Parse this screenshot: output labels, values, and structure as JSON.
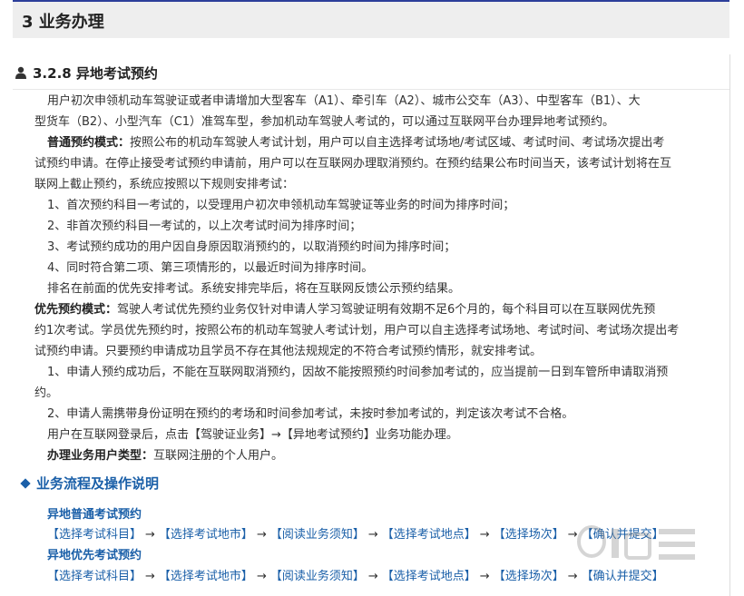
{
  "section": {
    "title": "3 业务办理"
  },
  "subsection": {
    "title": "3.2.8 异地考试预约"
  },
  "paragraphs": {
    "intro_1": "用户初次申领机动车驾驶证或者申请增加大型客车（A1）、牵引车（A2）、城市公交车（A3）、中型客车（B1）、大",
    "intro_2": "型货车（B2）、小型汽车（C1）准驾车型，参加机动车驾驶人考试的，可以通过互联网平台办理异地考试预约。",
    "normal_label": "普通预约模式：",
    "normal_1": "按照公布的机动车驾驶人考试计划，用户可以自主选择考试场地/考试区域、考试时间、考试场次提出考",
    "normal_2": "试预约申请。在停止接受考试预约申请前，用户可以在互联网办理取消预约。在预约结果公布时间当天，该考试计划将在互",
    "normal_3": "联网上截止预约，系统应按照以下规则安排考试：",
    "rule_1": "1、首次预约科目一考试的，以受理用户初次申领机动车驾驶证等业务的时间为排序时间；",
    "rule_2": "2、非首次预约科目一考试的，以上次考试时间为排序时间；",
    "rule_3": "3、考试预约成功的用户因自身原因取消预约的，以取消预约时间为排序时间；",
    "rule_4": "4、同时符合第二项、第三项情形的，以最近时间为排序时间。",
    "rule_end": "排名在前面的优先安排考试。系统安排完毕后，将在互联网反馈公示预约结果。",
    "priority_label": "优先预约模式：",
    "priority_1": "驾驶人考试优先预约业务仅针对申请人学习驾驶证明有效期不足6个月的，每个科目可以在互联网优先预",
    "priority_2": "约1次考试。学员优先预约时，按照公布的机动车驾驶人考试计划，用户可以自主选择考试场地、考试时间、考试场次提出考",
    "priority_3": "试预约申请。只要预约申请成功且学员不存在其他法规规定的不符合考试预约情形，就安排考试。",
    "p_rule_1a": "1、申请人预约成功后，不能在互联网取消预约，因故不能按照预约时间参加考试的，应当提前一日到车管所申请取消预",
    "p_rule_1b": "约。",
    "p_rule_2": "2、申请人需携带身份证明在预约的考场和时间参加考试，未按时参加考试的，判定该次考试不合格。",
    "login": "用户在互联网登录后，点击【驾驶证业务】→【异地考试预约】业务功能办理。",
    "user_type_label": "办理业务用户类型：",
    "user_type": "互联网注册的个人用户。"
  },
  "flow_section": {
    "title": "业务流程及操作说明"
  },
  "flows": {
    "normal_title": "异地普通考试预约",
    "priority_title": "异地优先考试预约",
    "normal_steps": [
      "【选择考试科目】",
      "【选择考试地市】",
      "【阅读业务须知】",
      "【选择考试地点】",
      "【选择场次】",
      "【确认并提交】"
    ],
    "priority_steps": [
      "【选择考试科目】",
      "【选择考试地市】",
      "【阅读业务须知】",
      "【选择考试地点】",
      "【选择场次】",
      "【确认并提交】"
    ],
    "arrow": "→"
  },
  "colors": {
    "accent": "#1a5fa8",
    "header_bg": "#eeeeee",
    "header_border": "#2c3e9a"
  }
}
